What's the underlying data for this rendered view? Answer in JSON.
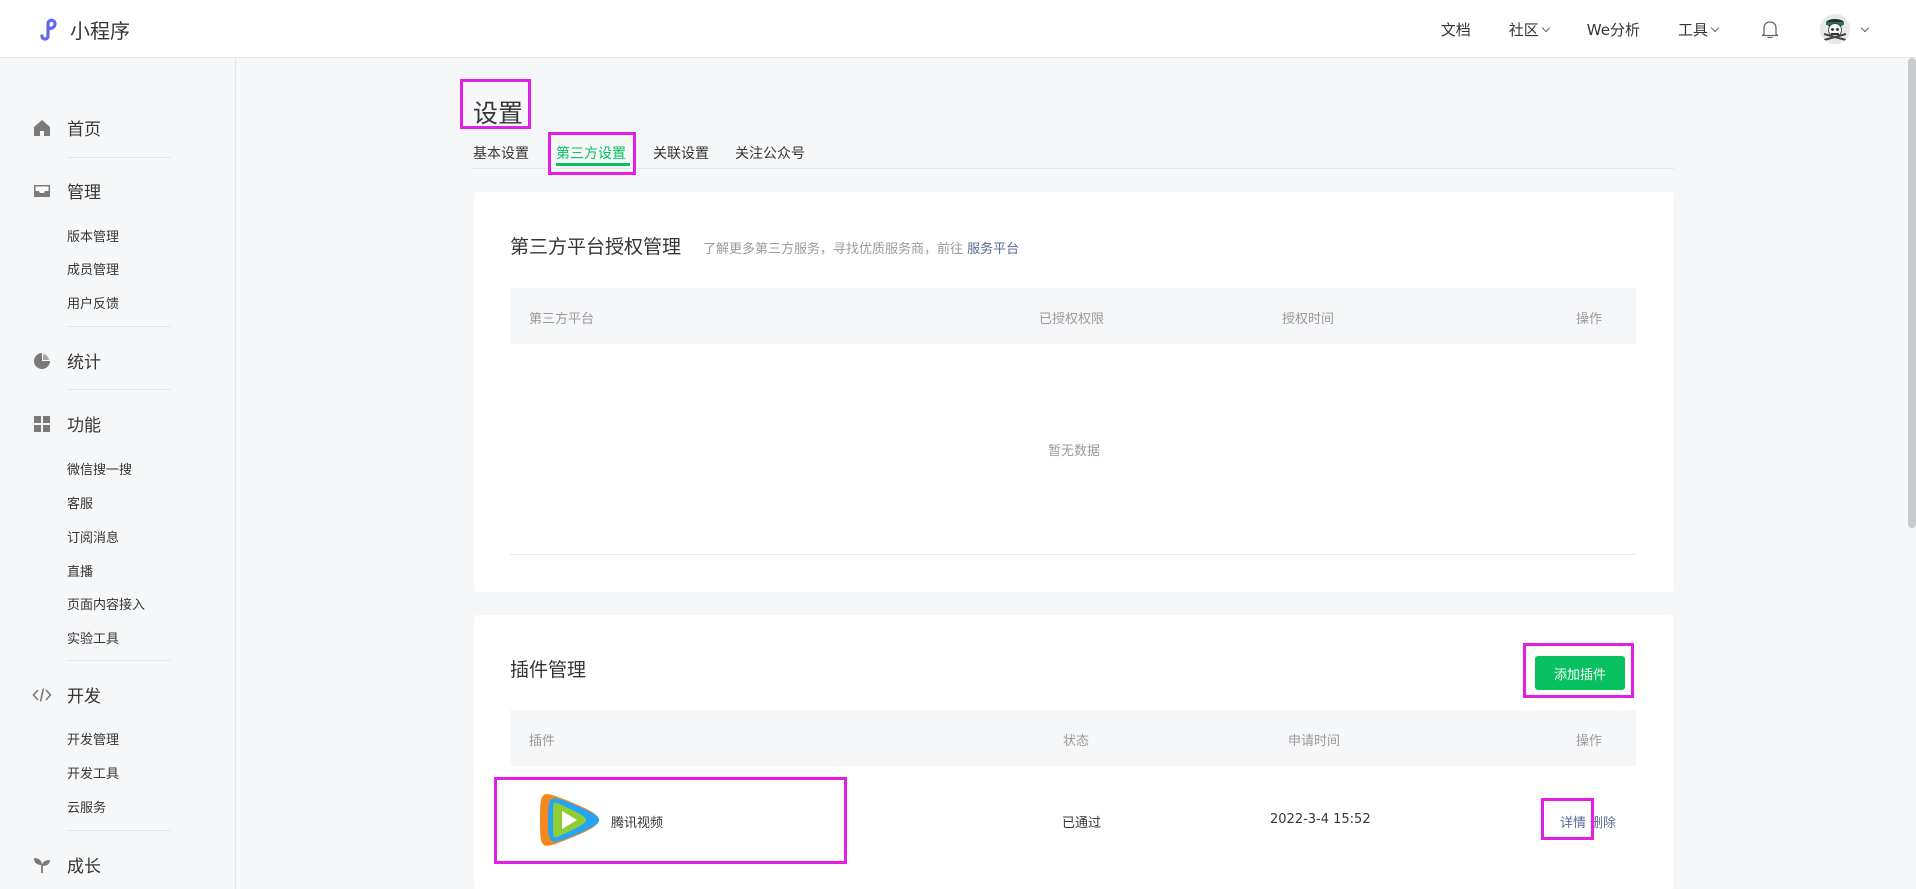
{
  "app": {
    "name": "小程序"
  },
  "topnav": {
    "docs": "文档",
    "community": "社区",
    "we_analytics": "We分析",
    "tools": "工具"
  },
  "sidebar": {
    "home": "首页",
    "manage": "管理",
    "manage_items": [
      "版本管理",
      "成员管理",
      "用户反馈"
    ],
    "stats": "统计",
    "features": "功能",
    "feature_items": [
      "微信搜一搜",
      "客服",
      "订阅消息",
      "直播",
      "页面内容接入",
      "实验工具"
    ],
    "dev": "开发",
    "dev_items": [
      "开发管理",
      "开发工具",
      "云服务"
    ],
    "growth": "成长"
  },
  "page": {
    "title": "设置",
    "tabs": [
      "基本设置",
      "第三方设置",
      "关联设置",
      "关注公众号"
    ],
    "active_tab": "第三方设置"
  },
  "third_party": {
    "title": "第三方平台授权管理",
    "desc": "了解更多第三方服务，寻找优质服务商，前往 ",
    "desc_link": "服务平台",
    "columns": [
      "第三方平台",
      "已授权权限",
      "授权时间",
      "操作"
    ],
    "empty_text": "暂无数据"
  },
  "plugins": {
    "title": "插件管理",
    "add_button": "添加插件",
    "columns": [
      "插件",
      "状态",
      "申请时间",
      "操作"
    ],
    "rows": [
      {
        "name": "腾讯视频",
        "status": "已通过",
        "time": "2022-3-4 15:52",
        "detail": "详情",
        "delete": "删除"
      }
    ]
  },
  "colors": {
    "accent": "#07c160",
    "link": "#576b95",
    "highlight": "#e51ee5"
  }
}
